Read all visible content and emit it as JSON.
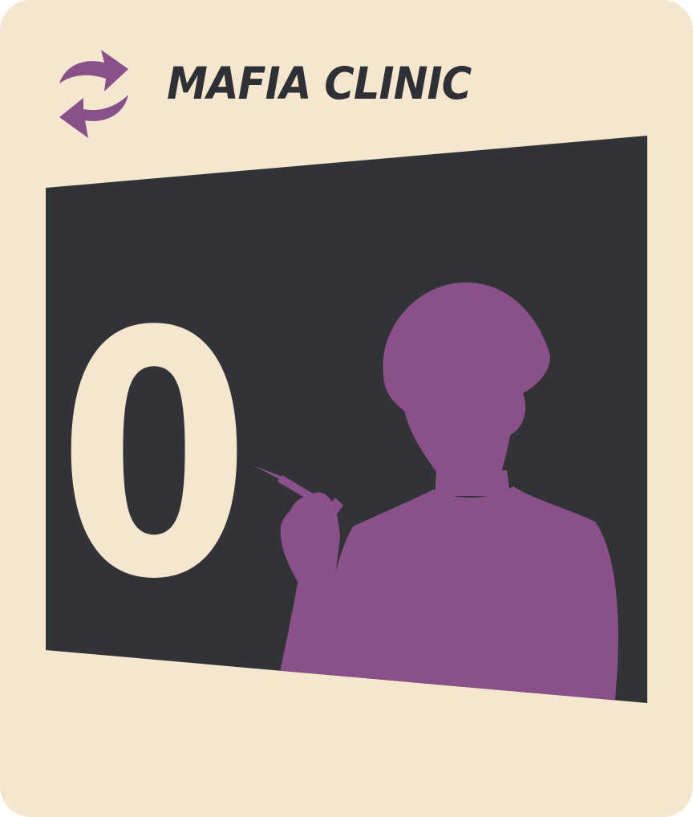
{
  "card": {
    "title": "MAFIA CLINIC",
    "number": "0",
    "corner_icon": "swap-arrows-icon",
    "illustration": "doctor-with-syringe-silhouette"
  },
  "colors": {
    "card_background": "#f5e7cf",
    "panel": "#323337",
    "accent": "#8a5089",
    "title_text": "#2f3035",
    "number_text": "#f5e7cf"
  }
}
